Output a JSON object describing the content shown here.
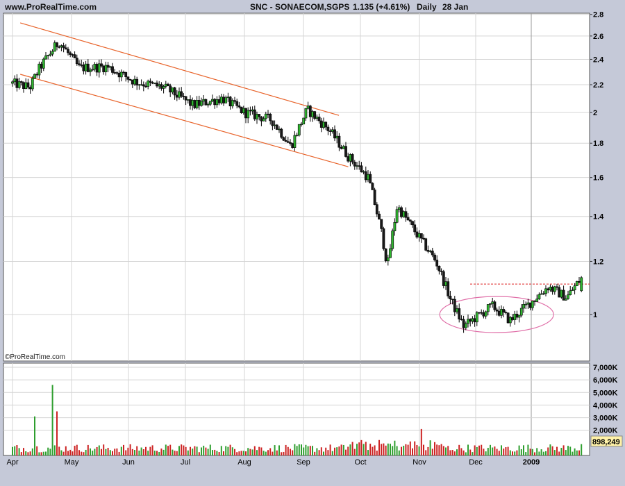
{
  "header": {
    "site": "www.ProRealTime.com",
    "instrument": "SNC - SONAECOM,SGPS",
    "price_change": "1.135 (+4.61%)",
    "period": "Daily",
    "date": "28 Jan"
  },
  "watermark": "©ProRealTime.com",
  "volume_last_label": "898,249",
  "colors": {
    "background": "#ffffff",
    "frame_bg": "#c5c9d8",
    "grid": "#d4d4d4",
    "up": "#2e9e2e",
    "down": "#cc2222",
    "channel": "#e8632a",
    "ellipse": "#e06fa8",
    "resistance": "#dd2222",
    "volume_label_bg": "#fff2a8"
  },
  "chart_data": [
    {
      "type": "candlestick",
      "panel": "price",
      "title": "SNC - SONAECOM,SGPS",
      "x_labels": [
        "Apr",
        "May",
        "Jun",
        "Jul",
        "Aug",
        "Sep",
        "Oct",
        "Nov",
        "Dec",
        "2009"
      ],
      "y_ticks": [
        1,
        1.2,
        1.4,
        1.6,
        1.8,
        2,
        2.2,
        2.4,
        2.6,
        2.8
      ],
      "y_scale": "log",
      "ylim": [
        0.88,
        2.85
      ],
      "grid": true,
      "last_close": 1.135,
      "change_pct": 4.61,
      "keypoints": [
        {
          "date": "Apr 1",
          "close": 2.21
        },
        {
          "date": "Apr 10",
          "close": 2.18
        },
        {
          "date": "Apr 15",
          "close": 2.33
        },
        {
          "date": "Apr 25",
          "close": 2.55
        },
        {
          "date": "May 5",
          "close": 2.33
        },
        {
          "date": "May 20",
          "close": 2.34
        },
        {
          "date": "Jun 5",
          "close": 2.22
        },
        {
          "date": "Jun 20",
          "close": 2.18
        },
        {
          "date": "Jul 5",
          "close": 2.05
        },
        {
          "date": "Jul 20",
          "close": 2.1
        },
        {
          "date": "Aug 1",
          "close": 2.0
        },
        {
          "date": "Aug 15",
          "close": 1.95
        },
        {
          "date": "Aug 25",
          "close": 1.78
        },
        {
          "date": "Sep 3",
          "close": 2.02
        },
        {
          "date": "Sep 15",
          "close": 1.88
        },
        {
          "date": "Sep 25",
          "close": 1.72
        },
        {
          "date": "Oct 5",
          "close": 1.6
        },
        {
          "date": "Oct 12",
          "close": 1.32
        },
        {
          "date": "Oct 15",
          "close": 1.18
        },
        {
          "date": "Oct 20",
          "close": 1.45
        },
        {
          "date": "Nov 1",
          "close": 1.3
        },
        {
          "date": "Nov 10",
          "close": 1.2
        },
        {
          "date": "Nov 18",
          "close": 1.05
        },
        {
          "date": "Nov 25",
          "close": 0.96
        },
        {
          "date": "Dec 10",
          "close": 1.03
        },
        {
          "date": "Dec 20",
          "close": 0.98
        },
        {
          "date": "Jan 2",
          "close": 1.05
        },
        {
          "date": "Jan 10",
          "close": 1.1
        },
        {
          "date": "Jan 20",
          "close": 1.06
        },
        {
          "date": "Jan 28",
          "close": 1.135
        }
      ],
      "annotations": [
        {
          "type": "trend-channel",
          "upper": [
            {
              "date": "Apr 5",
              "price": 2.72
            },
            {
              "date": "Sep 20",
              "price": 1.98
            }
          ],
          "lower": [
            {
              "date": "Apr 5",
              "price": 2.28
            },
            {
              "date": "Sep 25",
              "price": 1.66
            }
          ]
        },
        {
          "type": "ellipse",
          "from": "Nov 15",
          "to": "Jan 10",
          "price_center": 1.0
        },
        {
          "type": "resistance-line",
          "from": "Dec 1",
          "to": "Jan 30",
          "price": 1.11
        }
      ]
    },
    {
      "type": "bar",
      "panel": "volume",
      "y_ticks": [
        "2,000K",
        "3,000K",
        "4,000K",
        "5,000K",
        "6,000K",
        "7,000K"
      ],
      "ylim": [
        0,
        7000
      ],
      "unit": "K",
      "last_value": 898.249,
      "peaks": [
        {
          "date": "Apr 22",
          "value": 5600
        },
        {
          "date": "Apr 24",
          "value": 3500
        },
        {
          "date": "Apr 12",
          "value": 3100
        },
        {
          "date": "Nov 2",
          "value": 2100
        }
      ]
    }
  ]
}
